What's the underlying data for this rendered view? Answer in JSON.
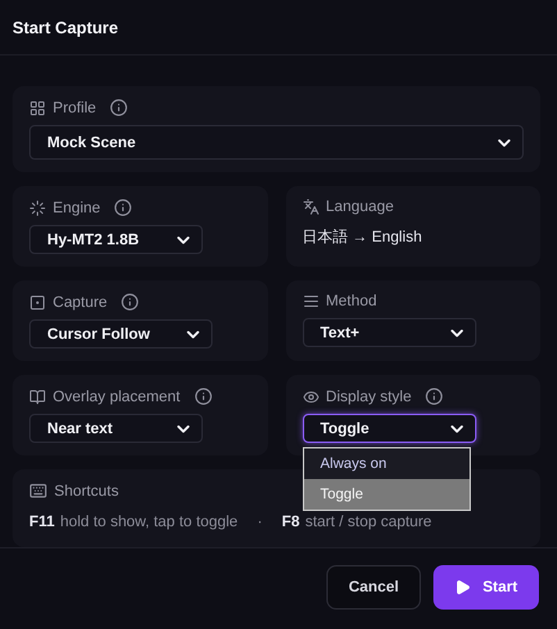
{
  "title": "Start Capture",
  "profile": {
    "label": "Profile",
    "info": true,
    "value": "Mock Scene"
  },
  "fields": [
    {
      "label": "Engine",
      "info": true,
      "kind": "select",
      "value": "Hy-MT2 1.8B",
      "focused": false
    },
    {
      "label": "Language",
      "info": false,
      "kind": "text",
      "value": "日本語 → English"
    },
    {
      "label": "Capture",
      "info": true,
      "kind": "select",
      "value": "Cursor Follow",
      "focused": false
    },
    {
      "label": "Method",
      "info": false,
      "kind": "select",
      "value": "Text+",
      "focused": false
    },
    {
      "label": "Overlay placement",
      "info": true,
      "kind": "select",
      "value": "Near text",
      "focused": false
    },
    {
      "label": "Display style",
      "info": true,
      "kind": "select",
      "value": "Toggle",
      "focused": true,
      "open": true,
      "options": [
        {
          "label": "Always on",
          "selected": false
        },
        {
          "label": "Toggle",
          "selected": true
        }
      ]
    }
  ],
  "shortcuts": {
    "label": "Shortcuts",
    "separator": "·",
    "items": [
      {
        "key": "F11",
        "desc": "hold to show, tap to toggle"
      },
      {
        "key": "F8",
        "desc": "start / stop capture"
      }
    ]
  },
  "buttons": {
    "cancel": "Cancel",
    "start": "Start"
  }
}
